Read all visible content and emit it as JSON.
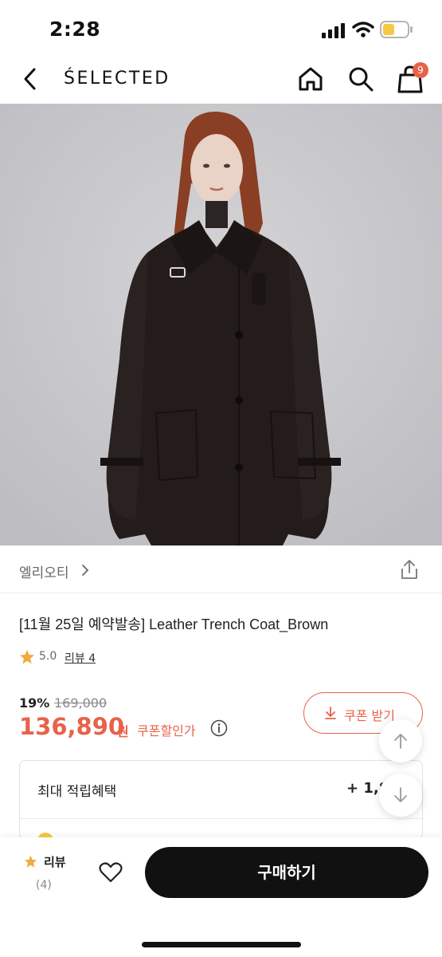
{
  "status_bar": {
    "time": "2:28",
    "icons": [
      "signal-icon",
      "wifi-icon",
      "battery-icon"
    ],
    "battery_color": "#f5c842"
  },
  "nav": {
    "brand": "ŚELECTED",
    "cart_count": "9",
    "icons": [
      "back-icon",
      "home-icon",
      "search-icon",
      "cart-icon"
    ]
  },
  "product": {
    "brand_name": "엘리오티",
    "title": "[11월 25일 예약발송] Leather Trench Coat_Brown",
    "rating": "5.0",
    "review_label": "리뷰 4",
    "discount_rate": "19%",
    "original_price": "169,000",
    "sale_price": "136,890",
    "currency": "원",
    "coupon_price_label": "쿠폰할인가",
    "coupon_button_label": "쿠폰 받기"
  },
  "benefit": {
    "title": "최대 적립혜택",
    "amount": "+ 1,8"
  },
  "bottom_bar": {
    "review_label": "리뷰",
    "review_count": "(4)",
    "buy_label": "구매하기"
  },
  "colors": {
    "accent": "#e8624a",
    "star": "#f0a93b",
    "buy_button": "#111111"
  }
}
